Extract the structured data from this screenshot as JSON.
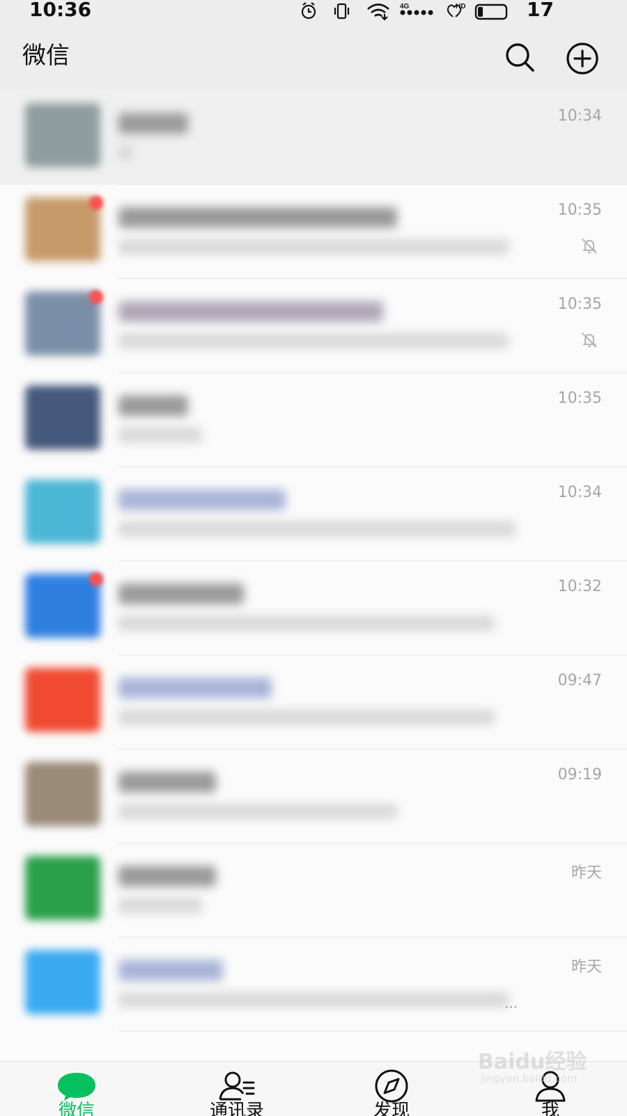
{
  "status_bar": {
    "time": "10:36",
    "network": "4G",
    "hd": "HD",
    "battery": "17"
  },
  "header": {
    "title": "微信"
  },
  "chats": [
    {
      "time": "10:34",
      "muted": false,
      "badge": false,
      "pinned": true,
      "avatar_color": "#8f9da0",
      "name_color": "#9a9a9a",
      "show_ellipsis": false
    },
    {
      "time": "10:35",
      "muted": true,
      "badge": true,
      "pinned": false,
      "avatar_color": "#c79a6a",
      "name_color": "#9a9a9a",
      "show_ellipsis": false
    },
    {
      "time": "10:35",
      "muted": true,
      "badge": true,
      "pinned": false,
      "avatar_color": "#7c8fa8",
      "name_color": "#b0a7b8",
      "show_ellipsis": false
    },
    {
      "time": "10:35",
      "muted": false,
      "badge": false,
      "pinned": false,
      "avatar_color": "#45597c",
      "name_color": "#9a9a9a",
      "show_ellipsis": false
    },
    {
      "time": "10:34",
      "muted": false,
      "badge": false,
      "pinned": false,
      "avatar_color": "#4bb6d6",
      "name_color": "#a8b4d8",
      "show_ellipsis": false
    },
    {
      "time": "10:32",
      "muted": false,
      "badge": true,
      "pinned": false,
      "avatar_color": "#2f7fe0",
      "name_color": "#9a9a9a",
      "show_ellipsis": false
    },
    {
      "time": "09:47",
      "muted": false,
      "badge": false,
      "pinned": false,
      "avatar_color": "#f04a32",
      "name_color": "#a8b4d8",
      "show_ellipsis": false
    },
    {
      "time": "09:19",
      "muted": false,
      "badge": false,
      "pinned": false,
      "avatar_color": "#9a8a78",
      "name_color": "#9a9a9a",
      "show_ellipsis": false
    },
    {
      "time": "昨天",
      "muted": false,
      "badge": false,
      "pinned": false,
      "avatar_color": "#2aa04a",
      "name_color": "#9a9a9a",
      "show_ellipsis": false
    },
    {
      "time": "昨天",
      "muted": false,
      "badge": false,
      "pinned": false,
      "avatar_color": "#3aaaf0",
      "name_color": "#a8b4d8",
      "show_ellipsis": true,
      "ellipsis": "..."
    }
  ],
  "bottom_nav": [
    {
      "label": "微信",
      "icon": "chat-bubble-icon",
      "active": true
    },
    {
      "label": "通讯录",
      "icon": "contacts-icon",
      "active": false
    },
    {
      "label": "发现",
      "icon": "compass-icon",
      "active": false
    },
    {
      "label": "我",
      "icon": "person-icon",
      "active": false
    }
  ],
  "watermark": {
    "main": "Baidu经验",
    "sub": "jingyan.baidu.com"
  },
  "colors": {
    "accent": "#07c160",
    "header_bg": "#ededed",
    "badge": "#fa5151"
  }
}
